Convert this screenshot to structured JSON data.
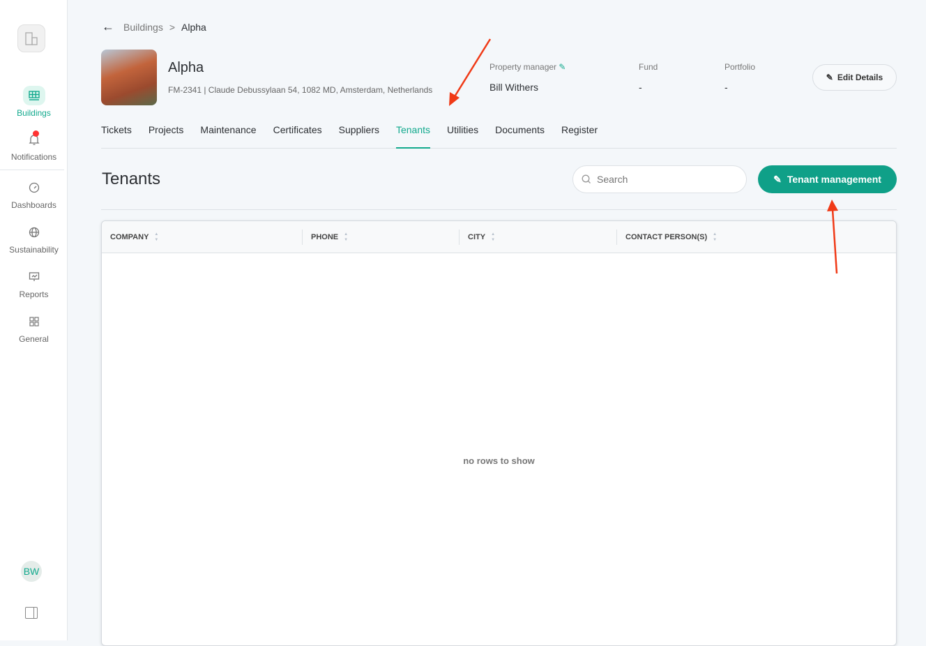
{
  "sidebar": {
    "items": [
      {
        "label": "Buildings"
      },
      {
        "label": "Notifications"
      },
      {
        "label": "Dashboards"
      },
      {
        "label": "Sustainability"
      },
      {
        "label": "Reports"
      },
      {
        "label": "General"
      }
    ],
    "avatar": "BW"
  },
  "breadcrumb": {
    "parent": "Buildings",
    "sep": ">",
    "current": "Alpha"
  },
  "building": {
    "name": "Alpha",
    "subtitle": "FM-2341 | Claude Debussylaan 54, 1082 MD, Amsterdam, Netherlands"
  },
  "meta": {
    "pm_label": "Property manager",
    "pm_value": "Bill Withers",
    "fund_label": "Fund",
    "fund_value": "-",
    "portfolio_label": "Portfolio",
    "portfolio_value": "-"
  },
  "edit_label": "Edit Details",
  "tabs": [
    "Tickets",
    "Projects",
    "Maintenance",
    "Certificates",
    "Suppliers",
    "Tenants",
    "Utilities",
    "Documents",
    "Register"
  ],
  "section": {
    "title": "Tenants",
    "search_placeholder": "Search",
    "action": "Tenant management"
  },
  "table": {
    "columns": [
      "COMPANY",
      "PHONE",
      "CITY",
      "CONTACT PERSON(S)"
    ],
    "empty": "no rows to show"
  }
}
